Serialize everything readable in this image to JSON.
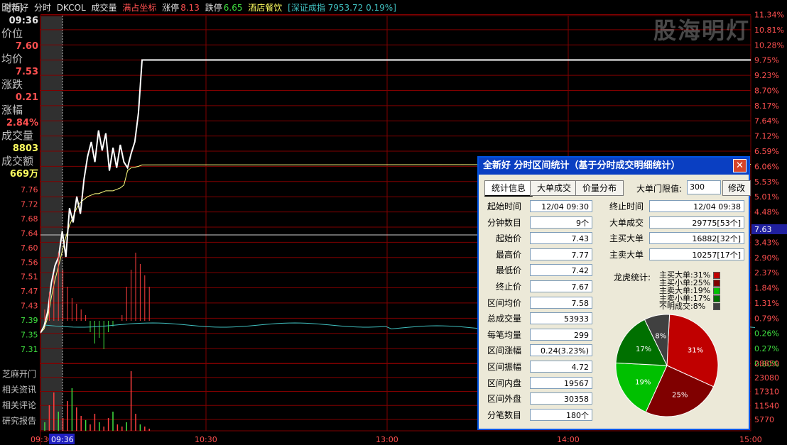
{
  "topbar": {
    "stock_name": "全新好",
    "mode": "分时",
    "indicator": "DKCOL",
    "volume_label": "成交量",
    "coord_label": "满占坐标",
    "limit_up_label": "涨停",
    "limit_up_value": "8.13",
    "limit_down_label": "跌停",
    "limit_down_value": "6.65",
    "sector": "酒店餐饮",
    "index_info": "[深证成指 7953.72 0.19%]"
  },
  "side": {
    "time_label": "时间",
    "time_value": "09:36",
    "price_label": "价位",
    "price_value": "7.60",
    "avg_label": "均价",
    "avg_value": "7.53",
    "change_label": "涨跌",
    "change_value": "0.21",
    "pct_label": "涨幅",
    "pct_value": "2.84%",
    "vol_label": "成交量",
    "vol_value": "8803",
    "amount_label": "成交额",
    "amount_value": "669万"
  },
  "links": [
    "芝麻开门",
    "相关资讯",
    "相关评论",
    "研究报告"
  ],
  "watermark": "股海明灯",
  "chart_data": {
    "type": "line",
    "title": "全新好 分时",
    "x_labels": [
      "09:30",
      "09:36",
      "10:30",
      "13:00",
      "14:00",
      "15:00"
    ],
    "price_axis": [
      "7.76",
      "7.72",
      "7.68",
      "7.64",
      "7.60",
      "7.56",
      "7.51",
      "7.47",
      "7.43",
      "7.39",
      "7.35",
      "7.31"
    ],
    "pct_axis": [
      "11.34%",
      "10.81%",
      "10.28%",
      "9.75%",
      "9.23%",
      "8.70%",
      "8.17%",
      "7.64%",
      "7.12%",
      "6.59%",
      "6.06%",
      "5.53%",
      "5.01%",
      "4.48%",
      "3.95%",
      "3.43%",
      "2.90%",
      "2.37%",
      "1.84%",
      "1.31%",
      "0.79%",
      "0.26%",
      "0.27%",
      "0.80%"
    ],
    "vol_axis": [
      "28850",
      "23080",
      "17310",
      "11540",
      "5770"
    ],
    "current_price_tag": "7.63",
    "price_series": [
      0.26,
      0.5,
      1.0,
      2.0,
      2.6,
      2.9,
      3.8,
      2.9,
      4.6,
      4.1,
      5.0,
      4.4,
      5.6,
      6.4,
      6.9,
      6.2,
      7.3,
      6.6,
      7.2,
      5.9,
      6.7,
      6.0,
      6.8,
      6.2,
      6.0,
      6.5,
      6.9,
      7.9,
      9.75,
      9.75
    ],
    "avg_series": [
      0.26,
      0.4,
      0.8,
      1.5,
      2.1,
      2.6,
      3.1,
      3.6,
      4.0,
      4.3,
      4.6,
      4.8,
      4.9,
      5.0,
      5.05,
      5.1,
      5.1,
      5.15,
      5.2,
      5.2,
      5.2,
      5.25,
      5.3,
      5.4,
      5.9,
      6.0,
      6.02,
      6.05,
      6.1,
      6.12
    ],
    "price_pct_range": [
      -0.8,
      11.34
    ],
    "indicator_bars": [
      2,
      5,
      8,
      12,
      9,
      6,
      4,
      3,
      2,
      1,
      -2,
      -4,
      -3,
      -5,
      -2,
      -1,
      0,
      1,
      6,
      9,
      12,
      10,
      8,
      6
    ],
    "volume_bars": [
      4,
      12,
      18,
      9,
      6,
      14,
      20,
      11,
      7,
      5,
      3,
      8,
      4,
      2,
      6,
      9,
      3,
      2,
      4,
      28,
      8,
      3,
      2,
      1
    ]
  },
  "dialog": {
    "title": "全新好  分时区间统计（基于分时成交明细统计）",
    "tabs": [
      "统计信息",
      "大单成交",
      "价量分布"
    ],
    "threshold_label": "大单门限值:",
    "threshold_value": "300",
    "modify_label": "修改",
    "left_rows": [
      {
        "label": "起始时间",
        "value": "12/04 09:30"
      },
      {
        "label": "分钟数目",
        "value": "9个"
      },
      {
        "label": "起始价",
        "value": "7.43"
      },
      {
        "label": "最高价",
        "value": "7.77"
      },
      {
        "label": "最低价",
        "value": "7.42"
      },
      {
        "label": "终止价",
        "value": "7.67"
      },
      {
        "label": "区间均价",
        "value": "7.58"
      },
      {
        "label": "总成交量",
        "value": "53933"
      },
      {
        "label": "每笔均量",
        "value": "299"
      },
      {
        "label": "区间涨幅",
        "value": "0.24(3.23%)"
      },
      {
        "label": "区间振幅",
        "value": "4.72"
      },
      {
        "label": "区间内盘",
        "value": "19567"
      },
      {
        "label": "区间外盘",
        "value": "30358"
      },
      {
        "label": "分笔数目",
        "value": "180个"
      }
    ],
    "right_rows": [
      {
        "label": "终止时间",
        "value": "12/04 09:38"
      },
      {
        "label": "大单成交",
        "value": "29775[53个]"
      },
      {
        "label": "主买大单",
        "value": "16882[32个]"
      },
      {
        "label": "主卖大单",
        "value": "10257[17个]"
      }
    ],
    "lh_label": "龙虎统计:",
    "pie": [
      {
        "name": "主买大单",
        "pct": 31,
        "color": "#c00000"
      },
      {
        "name": "主买小单",
        "pct": 25,
        "color": "#800000"
      },
      {
        "name": "主卖大单",
        "pct": 19,
        "color": "#00c000"
      },
      {
        "name": "主卖小单",
        "pct": 17,
        "color": "#007000"
      },
      {
        "name": "不明成交",
        "pct": 8,
        "color": "#404040"
      }
    ]
  }
}
